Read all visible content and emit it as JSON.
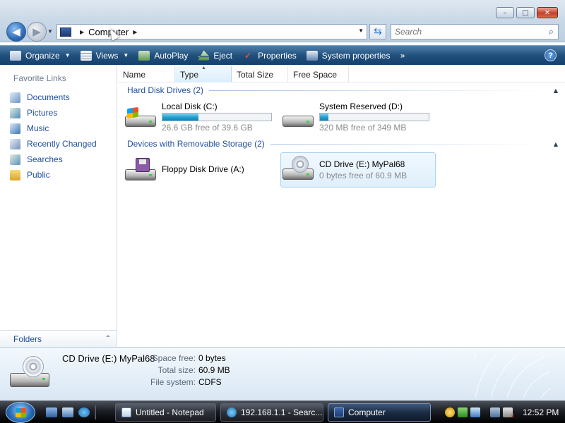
{
  "window": {
    "controls": {
      "minimize": "–",
      "maximize": "□",
      "close": "✕"
    },
    "nav": {
      "back": "◀",
      "forward": "▶"
    }
  },
  "address": {
    "location": "Computer"
  },
  "search": {
    "placeholder": "Search"
  },
  "toolbar": {
    "organize": "Organize",
    "views": "Views",
    "autoplay": "AutoPlay",
    "eject": "Eject",
    "properties": "Properties",
    "system_properties": "System properties",
    "more": "»",
    "help": "?"
  },
  "sidebar": {
    "favorite_links_title": "Favorite Links",
    "items": [
      {
        "label": "Documents",
        "icon": "documents-icon"
      },
      {
        "label": "Pictures",
        "icon": "pictures-icon"
      },
      {
        "label": "Music",
        "icon": "music-icon"
      },
      {
        "label": "Recently Changed",
        "icon": "recently-changed-icon"
      },
      {
        "label": "Searches",
        "icon": "searches-icon"
      },
      {
        "label": "Public",
        "icon": "public-folder-icon"
      }
    ],
    "folders_label": "Folders"
  },
  "columns": {
    "name": "Name",
    "type": "Type",
    "total_size": "Total Size",
    "free_space": "Free Space",
    "sorted_by": "Type"
  },
  "groups": {
    "hard_disks": {
      "title": "Hard Disk Drives (2)",
      "items": [
        {
          "name": "Local Disk (C:)",
          "detail": "26.6 GB free of 39.6 GB",
          "used_fraction": 0.33
        },
        {
          "name": "System Reserved (D:)",
          "detail": "320 MB free of 349 MB",
          "used_fraction": 0.08
        }
      ]
    },
    "removable": {
      "title": "Devices with Removable Storage (2)",
      "items": [
        {
          "name": "Floppy Disk Drive (A:)",
          "detail": ""
        },
        {
          "name": "CD Drive (E:) MyPal68",
          "detail": "0 bytes free of 60.9 MB",
          "selected": true
        }
      ]
    }
  },
  "details_pane": {
    "name": "CD Drive (E:) MyPal68",
    "fields": [
      {
        "label": "Space free:",
        "value": "0 bytes"
      },
      {
        "label": "Total size:",
        "value": "60.9 MB"
      },
      {
        "label": "File system:",
        "value": "CDFS"
      }
    ]
  },
  "taskbar": {
    "tasks": [
      {
        "label": "Untitled - Notepad",
        "icon": "notepad-icon"
      },
      {
        "label": "192.168.1.1 - Searc...",
        "icon": "internet-explorer-icon"
      },
      {
        "label": "Computer",
        "icon": "computer-icon",
        "active": true
      }
    ],
    "clock": "12:52 PM"
  },
  "colors": {
    "link_blue": "#1f4f9e",
    "command_bar": "#21507d",
    "progress_fill": "#1f9fd1",
    "selection": "#deeffc"
  }
}
